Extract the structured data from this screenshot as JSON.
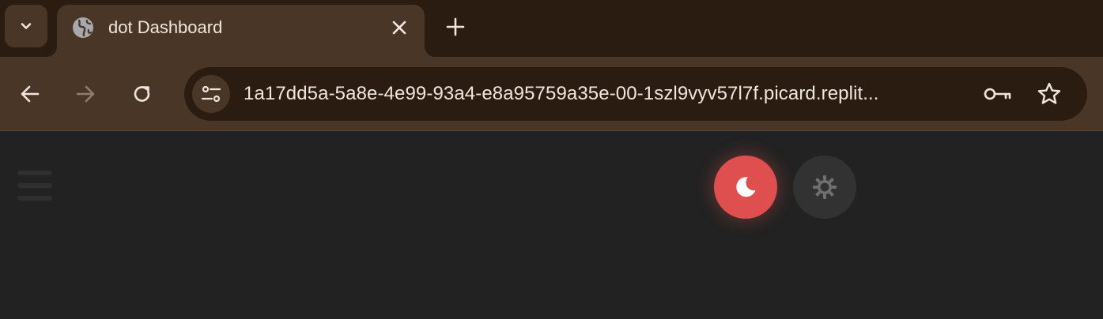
{
  "browser": {
    "tab_title": "dot Dashboard",
    "url": "1a17dd5a-5a8e-4e99-93a4-e8a95759a35e-00-1szl9vyv57l7f.picard.replit...",
    "colors": {
      "frame": "#2b1c11",
      "toolbar": "#4a3626",
      "text": "#efe6dd"
    }
  },
  "icons": {
    "tab_search": "chevron-down-icon",
    "favicon": "globe-icon",
    "close": "close-icon",
    "new_tab": "plus-icon",
    "back": "back-arrow-icon",
    "forward": "forward-arrow-icon",
    "reload": "reload-icon",
    "site_info": "tune-icon",
    "passwords": "key-icon",
    "bookmark": "star-icon"
  },
  "page": {
    "background": "#222222",
    "theme_toggle": {
      "dark_selected": true,
      "dark_color": "#df4f4f",
      "light_color": "#323232"
    }
  }
}
